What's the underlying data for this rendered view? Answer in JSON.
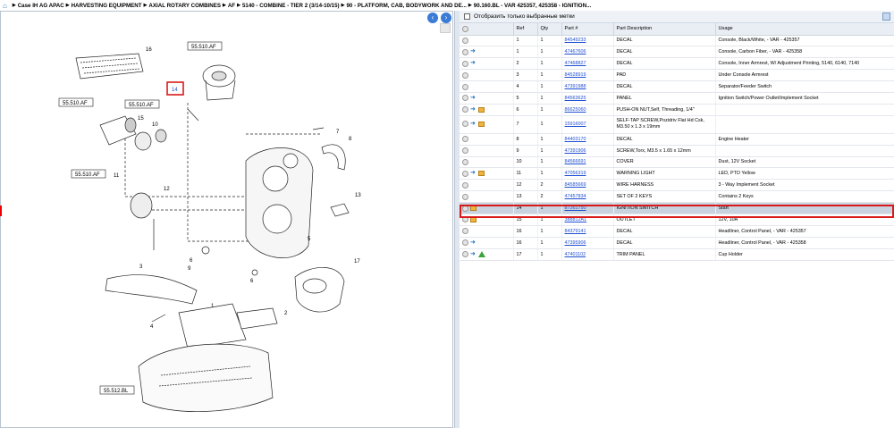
{
  "breadcrumb": {
    "items": [
      "Case IH AG APAC",
      "HARVESTING EQUIPMENT",
      "AXIAL ROTARY COMBINES",
      "AF",
      "5140 - COMBINE - TIER 2 (3/14-10/15)",
      "90 - PLATFORM, CAB, BODYWORK AND DE...",
      "90.160.BL - VAR 425357, 425358 - IGNITION..."
    ]
  },
  "diagram": {
    "callouts": [
      "55.510.AF",
      "55.510.AF",
      "55.510.AF",
      "55.510.AF",
      "55.512.BL"
    ],
    "highlighted_ref": "14",
    "numbers": [
      "16",
      "15",
      "10",
      "12",
      "1",
      "2",
      "3",
      "4",
      "5",
      "6",
      "6",
      "7",
      "8",
      "9",
      "11",
      "13",
      "17"
    ]
  },
  "right": {
    "filter_label": "Отобразить только выбранные метки",
    "columns": [
      "Ref",
      "Qty",
      "Part #",
      "Part Description",
      "Usage"
    ],
    "rows": [
      {
        "ref": "1",
        "qty": "1",
        "part": "84549233",
        "desc": "DECAL",
        "usage": "Console, Black/White, - VAR - 425357",
        "icons": []
      },
      {
        "ref": "1",
        "qty": "1",
        "part": "47467606",
        "desc": "DECAL",
        "usage": "Console, Carbon Fiber, - VAR - 425358",
        "icons": [
          "blue"
        ]
      },
      {
        "ref": "2",
        "qty": "1",
        "part": "47468827",
        "desc": "DECAL",
        "usage": "Console, Inner Armrest, W/ Adjustment Printing, 5140, 6140, 7140",
        "icons": [
          "blue"
        ]
      },
      {
        "ref": "3",
        "qty": "1",
        "part": "84528919",
        "desc": "PAD",
        "usage": "Under Console Armrest",
        "icons": []
      },
      {
        "ref": "4",
        "qty": "1",
        "part": "47391988",
        "desc": "DECAL",
        "usage": "Separator/Feeder Switch",
        "icons": []
      },
      {
        "ref": "5",
        "qty": "1",
        "part": "84563625",
        "desc": "PANEL",
        "usage": "Ignition Switch/Power Outlet/Implement Socket",
        "icons": [
          "blue"
        ]
      },
      {
        "ref": "6",
        "qty": "1",
        "part": "86625060",
        "desc": "PUSH-ON NUT,Self, Threading, 1/4\"",
        "usage": "",
        "icons": [
          "blue",
          "box"
        ]
      },
      {
        "ref": "7",
        "qty": "1",
        "part": "15916007",
        "desc": "SELF-TAP SCREW,Pozidriv Flat Hd Csk, M3.50 x 1.3 x 19mm",
        "usage": "",
        "icons": [
          "blue",
          "box"
        ],
        "tall": true
      },
      {
        "ref": "8",
        "qty": "1",
        "part": "84403170",
        "desc": "DECAL",
        "usage": "Engine Heater",
        "icons": []
      },
      {
        "ref": "9",
        "qty": "1",
        "part": "47391906",
        "desc": "SCREW,Torx, M3.5 x 1.65 x 12mm",
        "usage": "",
        "icons": []
      },
      {
        "ref": "10",
        "qty": "1",
        "part": "84566691",
        "desc": "COVER",
        "usage": "Dust, 12V Socket",
        "icons": []
      },
      {
        "ref": "11",
        "qty": "1",
        "part": "47056319",
        "desc": "WARNING LIGHT",
        "usage": "LED, PTO Yellow",
        "icons": [
          "blue",
          "box"
        ]
      },
      {
        "ref": "12",
        "qty": "2",
        "part": "84585669",
        "desc": "WIRE HARNESS",
        "usage": "3 - Way Implement Socket",
        "icons": []
      },
      {
        "ref": "13",
        "qty": "2",
        "part": "47457834",
        "desc": "SET OF 2 KEYS",
        "usage": "Contains 2 Keys",
        "icons": []
      },
      {
        "ref": "14",
        "qty": "1",
        "part": "87261750",
        "desc": "IGNITION SWITCH",
        "usage": "Start",
        "icons": [
          "box"
        ],
        "selected": true
      },
      {
        "ref": "15",
        "qty": "1",
        "part": "388812A1",
        "desc": "OUTLET",
        "usage": "12V, 10A",
        "icons": [
          "box"
        ]
      },
      {
        "ref": "16",
        "qty": "1",
        "part": "84379141",
        "desc": "DECAL",
        "usage": "Headliner, Control Panel, - VAR - 425357",
        "icons": []
      },
      {
        "ref": "16",
        "qty": "1",
        "part": "47395906",
        "desc": "DECAL",
        "usage": "Headliner, Control Panel, - VAR - 425358",
        "icons": [
          "blue"
        ]
      },
      {
        "ref": "17",
        "qty": "1",
        "part": "47401102",
        "desc": "TRIM PANEL",
        "usage": "Cup Holder",
        "icons": [
          "blue",
          "green"
        ]
      }
    ]
  }
}
